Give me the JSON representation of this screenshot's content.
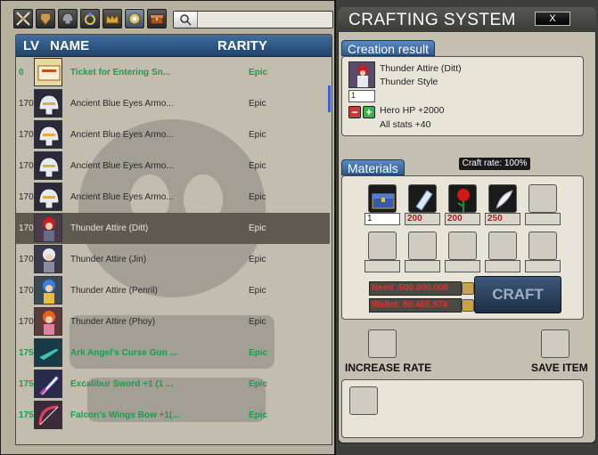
{
  "left": {
    "search": {
      "placeholder": "",
      "value": ""
    },
    "toolbar": [
      {
        "icon": "crossed-swords-icon"
      },
      {
        "icon": "armor-icon"
      },
      {
        "icon": "helmet-icon"
      },
      {
        "icon": "ring-icon"
      },
      {
        "icon": "crown-icon"
      },
      {
        "icon": "accessory-icon"
      },
      {
        "icon": "chest-icon"
      }
    ],
    "headers": {
      "lv": "LV",
      "name": "NAME",
      "rarity": "RARITY"
    },
    "items": [
      {
        "lv": "0",
        "name": "Ticket for Entering Sn...",
        "rarity": "Epic",
        "green": true,
        "icon": "ticket"
      },
      {
        "lv": "170",
        "name": "Ancient Blue Eyes Armo...",
        "rarity": "Epic",
        "green": false,
        "icon": "helm"
      },
      {
        "lv": "170",
        "name": "Ancient Blue Eyes Armo...",
        "rarity": "Epic",
        "green": false,
        "icon": "helm"
      },
      {
        "lv": "170",
        "name": "Ancient Blue Eyes Armo...",
        "rarity": "Epic",
        "green": false,
        "icon": "helm"
      },
      {
        "lv": "170",
        "name": "Ancient Blue Eyes Armo...",
        "rarity": "Epic",
        "green": false,
        "icon": "helm"
      },
      {
        "lv": "170",
        "name": "Thunder Attire (Ditt)",
        "rarity": "Epic",
        "green": false,
        "icon": "char-red",
        "selected": true
      },
      {
        "lv": "170",
        "name": "Thunder Attire (Jin)",
        "rarity": "Epic",
        "green": false,
        "icon": "char-white"
      },
      {
        "lv": "170",
        "name": "Thunder Attire (Penril)",
        "rarity": "Epic",
        "green": false,
        "icon": "char-blue"
      },
      {
        "lv": "170",
        "name": "Thunder Attire (Phoy)",
        "rarity": "Epic",
        "green": false,
        "icon": "char-orange"
      },
      {
        "lv": "175",
        "name": "Ark Angel's Curse Gun ...",
        "rarity": "Epic",
        "green": true,
        "icon": "gun"
      },
      {
        "lv": "175",
        "name": "Excalibur Sword +1 (1 ...",
        "rarity": "Epic",
        "green": true,
        "icon": "sword"
      },
      {
        "lv": "175",
        "name": "Falcon's Wings Bow +1(...",
        "rarity": "Epic",
        "green": true,
        "icon": "bow"
      }
    ]
  },
  "right": {
    "title": "CRAFTING SYSTEM",
    "close_label": "X",
    "creation": {
      "tab": "Creation result",
      "item_name": "Thunder Attire (Ditt)",
      "item_type": "Thunder Style",
      "quantity": "1",
      "stat1": "Hero HP +2000",
      "stat2": "All stats +40",
      "minus": "−",
      "plus": "+"
    },
    "materials": {
      "tab": "Materials",
      "craft_rate": "Craft rate: 100%",
      "slots": [
        {
          "icon": "chest",
          "qty": "1",
          "white": true
        },
        {
          "icon": "crystal",
          "qty": "200",
          "white": false
        },
        {
          "icon": "rose",
          "qty": "200",
          "white": false
        },
        {
          "icon": "feather",
          "qty": "250",
          "white": false
        },
        {
          "icon": "",
          "qty": "",
          "white": false
        },
        {
          "icon": "",
          "qty": "",
          "white": false
        },
        {
          "icon": "",
          "qty": "",
          "white": false
        },
        {
          "icon": "",
          "qty": "",
          "white": false
        },
        {
          "icon": "",
          "qty": "",
          "white": false
        },
        {
          "icon": "",
          "qty": "",
          "white": false
        }
      ],
      "need": "Need :500.000.000",
      "wallet": "Wallet: 80.465.974",
      "craft_label": "CRAFT"
    },
    "increase_rate_label": "INCREASE RATE",
    "save_item_label": "SAVE ITEM",
    "colors": {
      "accent_blue": "#3f6ea0",
      "green_item": "#1f9a50",
      "red_qty": "#b02020"
    }
  }
}
